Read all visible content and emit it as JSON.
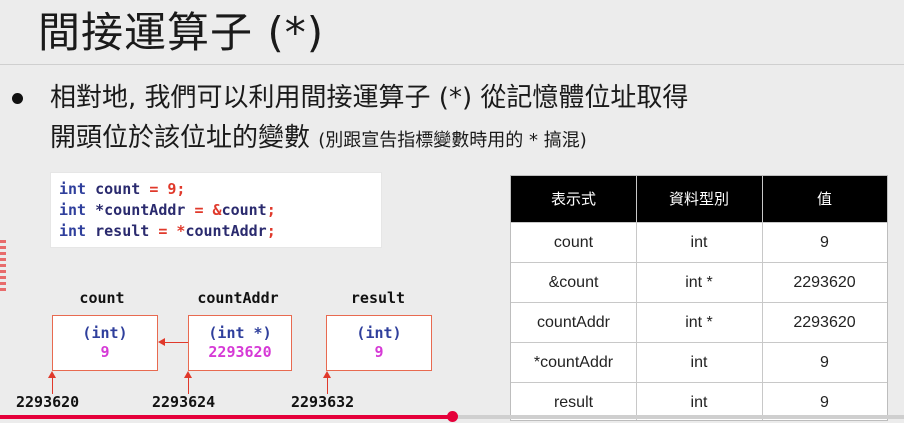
{
  "title": "間接運算子 (*)",
  "bullet": {
    "line1": "相對地, 我們可以利用間接運算子 (*) 從記憶體位址取得",
    "line2_main": "開頭位於該位址的變數 ",
    "line2_note": "(別跟宣告指標變數時用的 * 搞混)"
  },
  "code": [
    {
      "kw": "int ",
      "rest_txt": "count ",
      "op": "= ",
      "num": "9",
      "end": ";"
    },
    {
      "kw": "int ",
      "rest_txt": "*countAddr ",
      "op": "= &",
      "num": "",
      "end_txt": "count",
      "end": ";"
    },
    {
      "kw": "int ",
      "rest_txt": "result ",
      "op": "= *",
      "num": "",
      "end_txt": "countAddr",
      "end": ";"
    }
  ],
  "diagram": {
    "vars": [
      {
        "name": "count",
        "type": "(int)",
        "value": "9",
        "address": "2293620"
      },
      {
        "name": "countAddr",
        "type": "(int *)",
        "value": "2293620",
        "address": "2293624"
      },
      {
        "name": "result",
        "type": "(int)",
        "value": "9",
        "address": "2293632"
      }
    ]
  },
  "table": {
    "headers": [
      "表示式",
      "資料型別",
      "值"
    ],
    "rows": [
      [
        "count",
        "int",
        "9"
      ],
      [
        "&count",
        "int *",
        "2293620"
      ],
      [
        "countAddr",
        "int *",
        "2293620"
      ],
      [
        "*countAddr",
        "int",
        "9"
      ],
      [
        "result",
        "int",
        "9"
      ]
    ]
  },
  "player": {
    "progress": 0.5
  },
  "colors": {
    "accent": "#e5003a",
    "box_border": "#e86a50",
    "type_blue": "#2f3f9c",
    "value_magenta": "#d63ad6"
  }
}
